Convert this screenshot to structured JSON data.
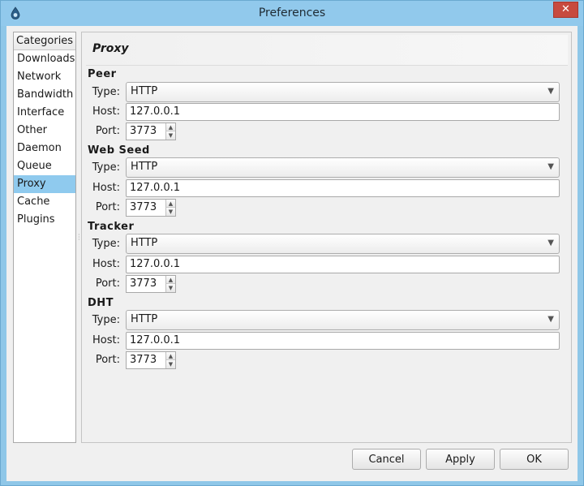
{
  "window": {
    "title": "Preferences",
    "close_label": "✕"
  },
  "categories": {
    "header": "Categories",
    "items": [
      "Downloads",
      "Network",
      "Bandwidth",
      "Interface",
      "Other",
      "Daemon",
      "Queue",
      "Proxy",
      "Cache",
      "Plugins"
    ],
    "selected": "Proxy"
  },
  "panel": {
    "title": "Proxy"
  },
  "labels": {
    "type": "Type:",
    "host": "Host:",
    "port": "Port:"
  },
  "sections": [
    {
      "title": "Peer",
      "type": "HTTP",
      "host": "127.0.0.1",
      "port": "3773"
    },
    {
      "title": "Web Seed",
      "type": "HTTP",
      "host": "127.0.0.1",
      "port": "3773"
    },
    {
      "title": "Tracker",
      "type": "HTTP",
      "host": "127.0.0.1",
      "port": "3773"
    },
    {
      "title": "DHT",
      "type": "HTTP",
      "host": "127.0.0.1",
      "port": "3773"
    }
  ],
  "buttons": {
    "cancel": "Cancel",
    "apply": "Apply",
    "ok": "OK"
  },
  "icons": {
    "app": "deluge-icon",
    "dropdown": "chevron-down-icon",
    "spin_up": "spin-up-icon",
    "spin_down": "spin-down-icon"
  },
  "colors": {
    "titlebar": "#91c9ec",
    "selection": "#8fcaee",
    "close": "#c74a3f"
  }
}
